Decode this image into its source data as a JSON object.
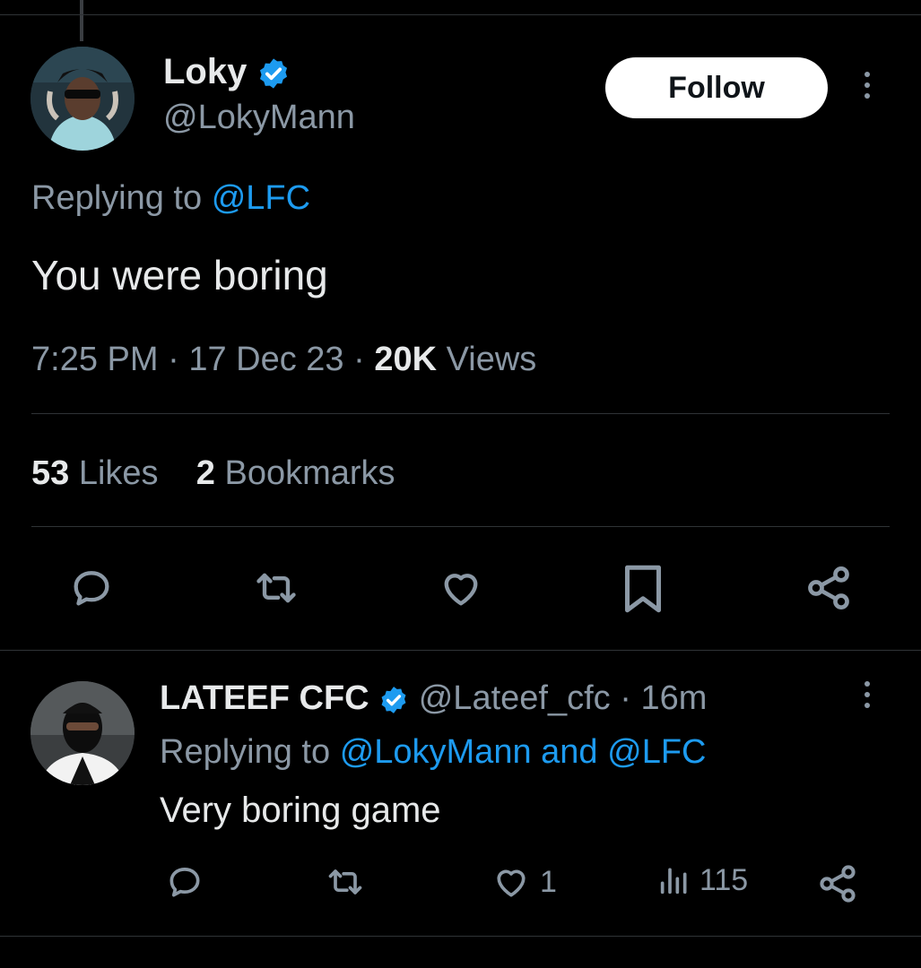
{
  "tweet": {
    "author_name": "Loky",
    "author_handle": "@LokyMann",
    "follow_label": "Follow",
    "replying_prefix": "Replying to",
    "replying_to": "@LFC",
    "text": "You were boring",
    "time": "7:25 PM",
    "date": "17 Dec 23",
    "views_count": "20K",
    "views_label": "Views",
    "likes_count": "53",
    "likes_label": "Likes",
    "bookmarks_count": "2",
    "bookmarks_label": "Bookmarks",
    "actions": [
      "reply-icon",
      "retweet-icon",
      "like-icon",
      "bookmark-icon",
      "share-icon"
    ]
  },
  "reply": {
    "author_name": "LATEEF CFC",
    "author_handle": "@Lateef_cfc",
    "age": "16m",
    "replying_prefix": "Replying to",
    "replying_to_1": "@LokyMann",
    "replying_join": "and",
    "replying_to_2": "@LFC",
    "text": "Very boring game",
    "like_count": "1",
    "views_count": "115"
  },
  "colors": {
    "background": "#000000",
    "text_primary": "#e7e9ea",
    "text_secondary": "#8b98a5",
    "link": "#1d9bf0",
    "verified": "#1d9bf0",
    "divider": "#2f3336"
  }
}
